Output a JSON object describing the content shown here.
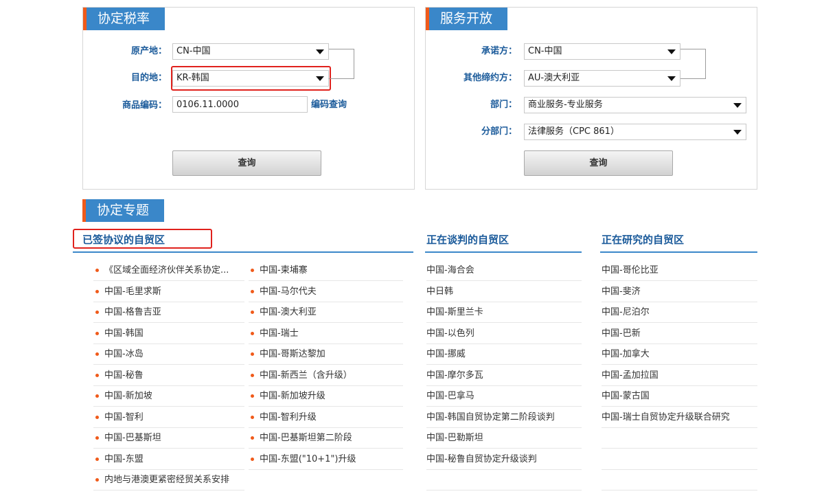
{
  "agreement_tariff": {
    "title": "协定税率",
    "origin_label": "原产地：",
    "origin_value": "CN-中国",
    "destination_label": "目的地：",
    "destination_value": "KR-韩国",
    "hs_code_label": "商品编码：",
    "hs_code_value": "0106.11.0000",
    "hs_lookup_link": "编码查询",
    "query_button": "查询"
  },
  "service_opening": {
    "title": "服务开放",
    "committer_label": "承诺方：",
    "committer_value": "CN-中国",
    "other_party_label": "其他缔约方：",
    "other_party_value": "AU-澳大利亚",
    "sector_label": "部门：",
    "sector_value": "商业服务-专业服务",
    "subsector_label": "分部门：",
    "subsector_value": "法律服务（CPC 861）",
    "query_button": "查询"
  },
  "topics": {
    "title": "协定专题",
    "signed": {
      "heading": "已签协议的自贸区",
      "col1": [
        "《区域全面经济伙伴关系协定...",
        "中国-毛里求斯",
        "中国-格鲁吉亚",
        "中国-韩国",
        "中国-冰岛",
        "中国-秘鲁",
        "中国-新加坡",
        "中国-智利",
        "中国-巴基斯坦",
        "中国-东盟",
        "内地与港澳更紧密经贸关系安排"
      ],
      "col2": [
        "中国-柬埔寨",
        "中国-马尔代夫",
        "中国-澳大利亚",
        "中国-瑞士",
        "中国-哥斯达黎加",
        "中国-新西兰（含升级）",
        "中国-新加坡升级",
        "中国-智利升级",
        "中国-巴基斯坦第二阶段",
        "中国-东盟(\"10+1\")升级"
      ]
    },
    "negotiating": {
      "heading": "正在谈判的自贸区",
      "items": [
        "中国-海合会",
        "中日韩",
        "中国-斯里兰卡",
        "中国-以色列",
        "中国-挪威",
        "中国-摩尔多瓦",
        "中国-巴拿马",
        "中国-韩国自贸协定第二阶段谈判",
        "中国-巴勒斯坦",
        "中国-秘鲁自贸协定升级谈判"
      ]
    },
    "researching": {
      "heading": "正在研究的自贸区",
      "items": [
        "中国-哥伦比亚",
        "中国-斐济",
        "中国-尼泊尔",
        "中国-巴新",
        "中国-加拿大",
        "中国-孟加拉国",
        "中国-蒙古国",
        "中国-瑞士自贸协定升级联合研究"
      ]
    }
  }
}
